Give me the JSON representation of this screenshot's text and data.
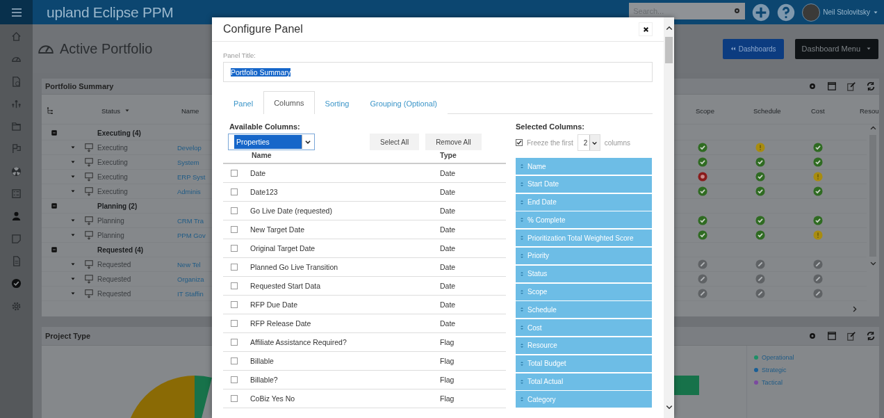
{
  "topbar": {
    "logo": "upland Eclipse PPM",
    "search": {
      "placeholder": "Search..."
    },
    "user": "Neil Stolovitsky"
  },
  "page": {
    "title": "Active Portfolio",
    "buttons": [
      {
        "label": "Dashboards",
        "kind": "back"
      },
      {
        "label": "Dashboard Menu",
        "kind": "menu"
      }
    ]
  },
  "portfolio_summary": {
    "title": "Portfolio Summary",
    "columns": [
      "Status",
      "Name",
      "Scope",
      "Schedule",
      "Cost",
      "Resou"
    ],
    "rows": [
      {
        "kind": "group",
        "label": "Executing (4)"
      },
      {
        "kind": "item",
        "status": "Executing",
        "name": "Develop",
        "indicators": [
          {
            "kind": "ok"
          },
          {
            "kind": "warning"
          },
          {
            "kind": "ok"
          }
        ]
      },
      {
        "kind": "item",
        "status": "Executing",
        "name": "System",
        "indicators": [
          {
            "kind": "ok"
          },
          {
            "kind": "ok"
          },
          {
            "kind": "ok"
          }
        ]
      },
      {
        "kind": "item",
        "status": "Executing",
        "name": "ERP Syst",
        "indicators": [
          {
            "kind": "critical"
          },
          {
            "kind": "ok"
          },
          {
            "kind": "warning"
          }
        ]
      },
      {
        "kind": "item",
        "status": "Executing",
        "name": "Adminis",
        "indicators": [
          {
            "kind": "ok"
          },
          {
            "kind": "ok"
          },
          {
            "kind": "ok"
          }
        ]
      },
      {
        "kind": "group",
        "label": "Planning (2)"
      },
      {
        "kind": "item",
        "status": "Planning",
        "name": "CRM Tra",
        "indicators": [
          {
            "kind": "ok"
          },
          {
            "kind": "ok"
          },
          {
            "kind": "ok"
          }
        ]
      },
      {
        "kind": "item",
        "status": "Planning",
        "name": "PPM Gov",
        "indicators": [
          {
            "kind": "ok"
          },
          {
            "kind": "ok"
          },
          {
            "kind": "warning"
          }
        ]
      },
      {
        "kind": "group",
        "label": "Requested (4)"
      },
      {
        "kind": "item",
        "status": "Requested",
        "name": "New Tel",
        "indicators": [
          {
            "kind": "na"
          },
          {
            "kind": "na"
          },
          {
            "kind": "na"
          }
        ]
      },
      {
        "kind": "item",
        "status": "Requested",
        "name": "Organiza",
        "indicators": [
          {
            "kind": "na"
          },
          {
            "kind": "na"
          },
          {
            "kind": "na"
          }
        ]
      },
      {
        "kind": "item",
        "status": "Requested",
        "name": "IT Staffin",
        "indicators": [
          {
            "kind": "na"
          },
          {
            "kind": "na"
          },
          {
            "kind": "na"
          }
        ]
      }
    ]
  },
  "project_type": {
    "title": "Project Type",
    "legend": [
      {
        "label": "Operational",
        "color": "#1e8f66"
      },
      {
        "label": "Strategic",
        "color": "#1a5f96"
      },
      {
        "label": "Tactical",
        "color": "#7b4aa0"
      }
    ]
  },
  "dialog": {
    "title": "Configure Panel",
    "panel_title": {
      "label": "Panel Title:",
      "value": "Portfolio Summary"
    },
    "tabs": [
      {
        "label": "Panel",
        "selected": false
      },
      {
        "label": "Columns",
        "selected": true
      },
      {
        "label": "Sorting",
        "selected": false
      },
      {
        "label": "Grouping (Optional)",
        "selected": false
      }
    ],
    "available": {
      "heading": "Available Columns:",
      "source": "Properties",
      "buttons": [
        "Select All",
        "Remove All"
      ],
      "columns": [
        "Name",
        "Type"
      ],
      "rows": [
        {
          "name": "Date",
          "type": "Date",
          "checked": false
        },
        {
          "name": "Date123",
          "type": "Date",
          "checked": false
        },
        {
          "name": "Go Live Date (requested)",
          "type": "Date",
          "checked": false
        },
        {
          "name": "New Target Date",
          "type": "Date",
          "checked": false
        },
        {
          "name": "Original Target Date",
          "type": "Date",
          "checked": false
        },
        {
          "name": "Planned Go Live Transition",
          "type": "Date",
          "checked": false
        },
        {
          "name": "Requested Start Data",
          "type": "Date",
          "checked": false
        },
        {
          "name": "RFP Due Date",
          "type": "Date",
          "checked": false
        },
        {
          "name": "RFP Release Date",
          "type": "Date",
          "checked": false
        },
        {
          "name": "Affiliate Assistance Required?",
          "type": "Flag",
          "checked": false
        },
        {
          "name": "Billable",
          "type": "Flag",
          "checked": false
        },
        {
          "name": "Billable?",
          "type": "Flag",
          "checked": false
        },
        {
          "name": "CoBiz Yes No",
          "type": "Flag",
          "checked": false
        }
      ]
    },
    "selected": {
      "heading": "Selected Columns:",
      "freeze": {
        "checked": true,
        "before": "Freeze the first",
        "count": "2",
        "after": "columns"
      },
      "items": [
        "Name",
        "Start Date",
        "End Date",
        "% Complete",
        "Prioritization Total Weighted Score",
        "Priority",
        "Status",
        "Scope",
        "Schedule",
        "Cost",
        "Resource",
        "Total Budget",
        "Total Actual",
        "Category"
      ]
    }
  }
}
